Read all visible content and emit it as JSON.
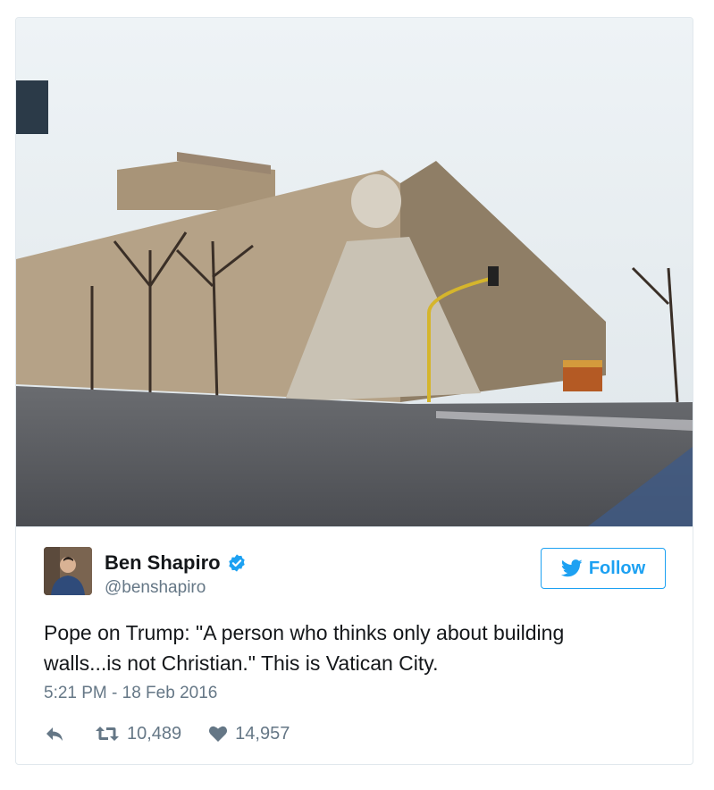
{
  "tweet": {
    "author": {
      "name": "Ben Shapiro",
      "handle": "@benshapiro",
      "verified": true
    },
    "follow_label": "Follow",
    "text_line1": "Pope on Trump: \"A person who thinks only about building",
    "text_line2": "walls...is not Christian.\" This is Vatican City.",
    "timestamp": "5:21 PM - 18 Feb 2016",
    "retweets": "10,489",
    "likes": "14,957"
  },
  "icons": {
    "reply": "reply-icon",
    "retweet": "retweet-icon",
    "like": "heart-icon",
    "verified": "verified-badge-icon",
    "follow": "twitter-bird-icon"
  },
  "colors": {
    "accent": "#1da1f2",
    "secondary_text": "#657786",
    "border": "#e1e8ed"
  }
}
